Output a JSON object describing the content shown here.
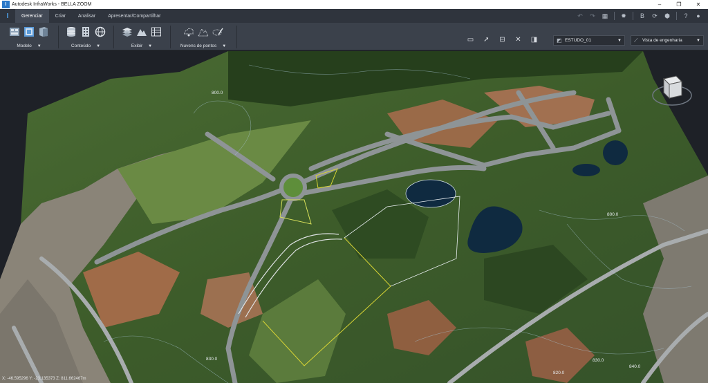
{
  "window": {
    "title": "Autodesk InfraWorks - BELLA ZOOM",
    "app_glyph": "I",
    "min": "–",
    "max": "❐",
    "close": "✕"
  },
  "menu": {
    "home_glyph": "I",
    "tabs": [
      {
        "label": "Gerenciar",
        "active": true
      },
      {
        "label": "Criar",
        "active": false
      },
      {
        "label": "Analisar",
        "active": false
      },
      {
        "label": "Apresentar/Compartilhar",
        "active": false
      }
    ],
    "right_icons": [
      "undo-icon",
      "redo-icon",
      "grid-icon",
      "settings-icon",
      "bim360-icon",
      "sync-icon",
      "cube-icon",
      "help-icon",
      "user-icon"
    ]
  },
  "ribbon": {
    "groups": [
      {
        "label": "Modelo",
        "icons": [
          "model-properties-icon",
          "model-explorer-icon",
          "layers-book-icon"
        ]
      },
      {
        "label": "Conteúdo",
        "icons": [
          "data-sources-icon",
          "building-grid-icon",
          "globe-icon"
        ]
      },
      {
        "label": "Exibir",
        "icons": [
          "surface-layers-icon",
          "terrain-icon",
          "table-icon"
        ]
      },
      {
        "label": "Nuvens de pontos",
        "icons": [
          "point-cloud-icon",
          "point-cloud-terrain-icon",
          "point-cloud-edit-icon"
        ]
      }
    ],
    "tools": [
      "present-icon",
      "select-icon",
      "measure-icon",
      "transform-icon",
      "clip-icon"
    ],
    "proposal_combo": {
      "value": "ESTUDO_01"
    },
    "view_combo": {
      "value": "Vista de engenharia"
    }
  },
  "viewport": {
    "coordinates": "X: -46.595296 Y: -23.135373 Z: 811.662467m",
    "contour_labels": [
      "800.0",
      "800.0",
      "830.0",
      "820.0",
      "830.0",
      "840.0"
    ]
  },
  "colors": {
    "accent": "#4ea0e8",
    "ribbon": "#3b414b",
    "menubar": "#2f343d",
    "terrain_dark": "#2f4a24",
    "terrain_light": "#5e7a3a",
    "soil": "#9a6a48",
    "road": "#8e9496",
    "water": "#0f2a40",
    "outline_yellow": "#d8d434"
  }
}
